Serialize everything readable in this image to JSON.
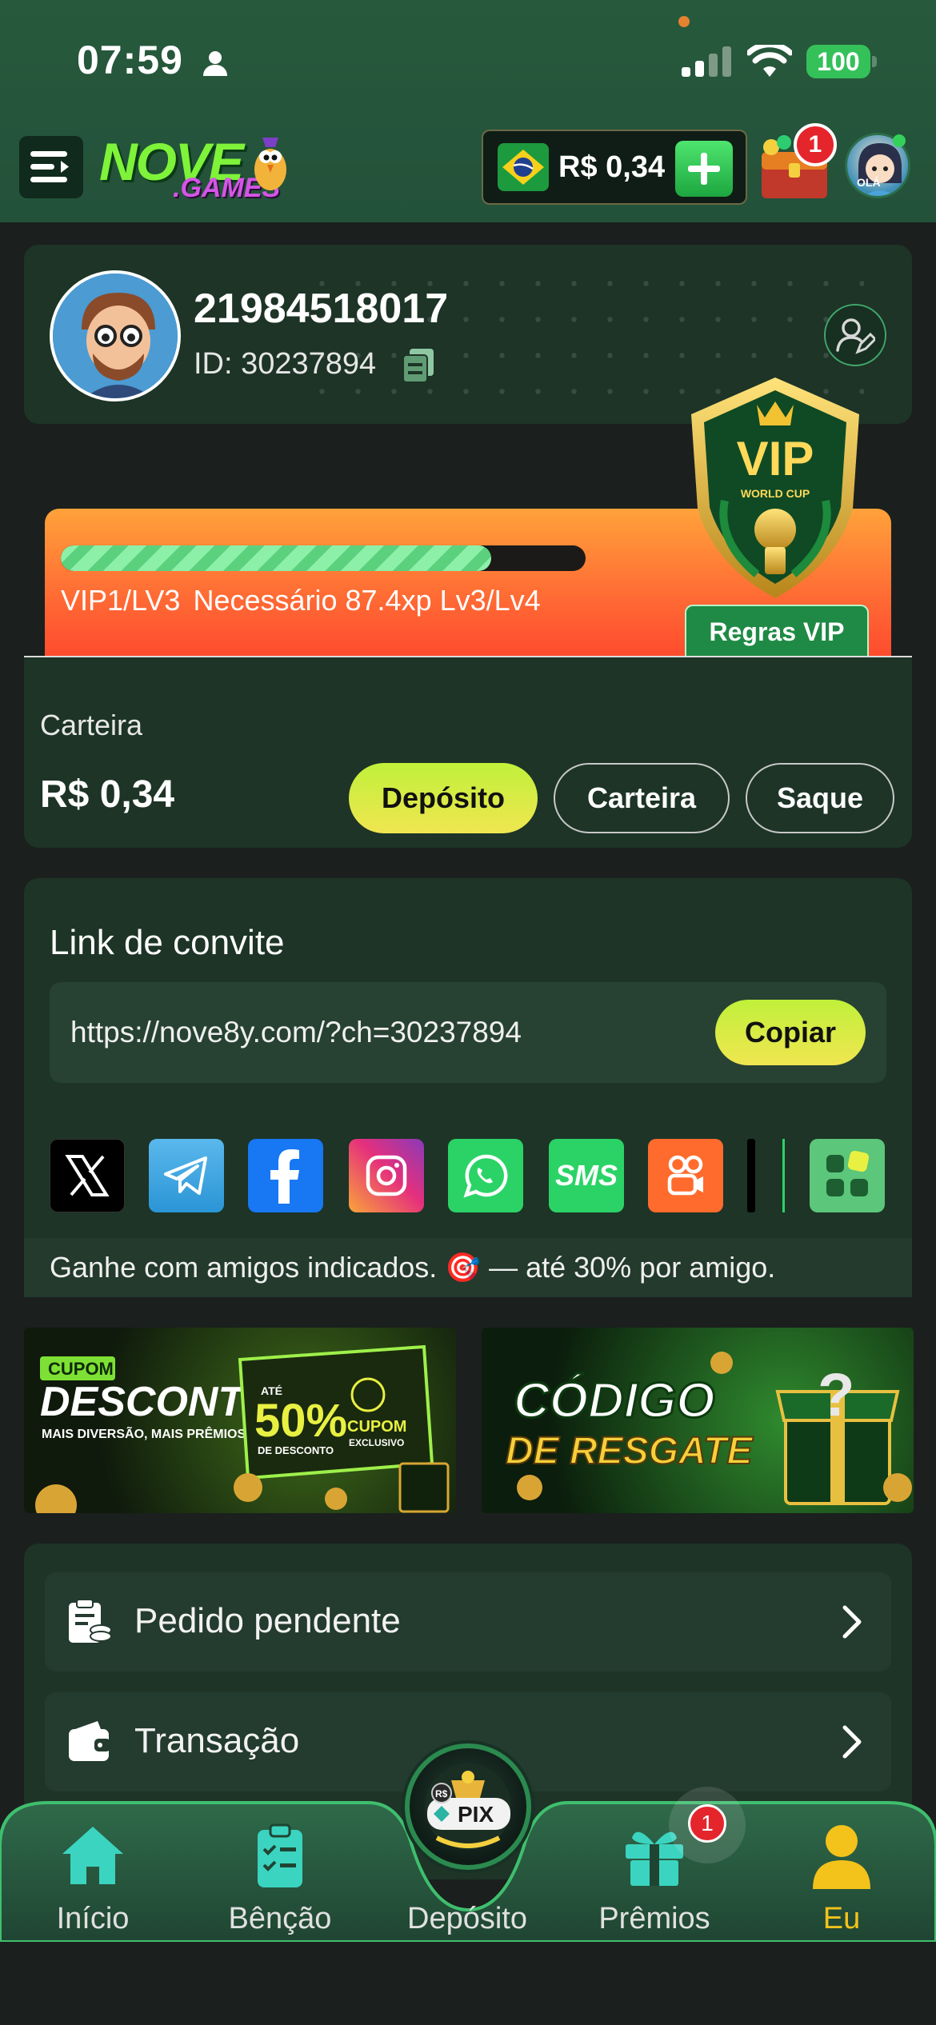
{
  "status_bar": {
    "time": "07:59",
    "battery": "100"
  },
  "header": {
    "logo_main": "NOVE",
    "logo_sub": ".GAMES",
    "balance": "R$ 0,34",
    "chest_badge": "1"
  },
  "profile": {
    "username": "21984518017",
    "id_label": "ID: 30237894"
  },
  "vip": {
    "level": "VIP1/LV3",
    "requirement": "Necessário 87.4xp Lv3/Lv4",
    "progress": 0.82,
    "badge_title": "VIP",
    "badge_sub": "WORLD CUP",
    "rules_label": "Regras VIP"
  },
  "wallet": {
    "title": "Carteira",
    "amount": "R$ 0,34",
    "deposit_label": "Depósito",
    "wallet_label": "Carteira",
    "withdraw_label": "Saque"
  },
  "invite": {
    "title": "Link de convite",
    "link": "https://nove8y.com/?ch=30237894",
    "copy_label": "Copiar",
    "note": "Ganhe com amigos indicados. 🎯 — até 30% por amigo.",
    "share_sms_label": "SMS"
  },
  "banners": {
    "coupon": {
      "tag": "CUPOM",
      "title": "DESCONTO",
      "sub": "MAIS DIVERSÃO, MAIS PRÊMIOS!",
      "percent": "50%",
      "percent_pre": "ATÉ",
      "percent_post": "DE DESCONTO",
      "ticket": "CUPOM",
      "ticket_sub": "EXCLUSIVO"
    },
    "redeem": {
      "line1": "CÓDIGO",
      "line2": "DE RESGATE"
    }
  },
  "menu": {
    "pending": "Pedido pendente",
    "transaction": "Transação"
  },
  "bottom_nav": {
    "home": "Início",
    "blessing": "Bênção",
    "deposit": "Depósito",
    "prizes": "Prêmios",
    "me": "Eu",
    "prizes_badge": "1",
    "pix_label": "PIX",
    "pix_rs": "R$"
  },
  "colors": {
    "accent_yellow": "#e8e64a",
    "accent_green": "#35c15a",
    "active_nav": "#f3c21b",
    "vip_orange": "#ff6a34"
  }
}
